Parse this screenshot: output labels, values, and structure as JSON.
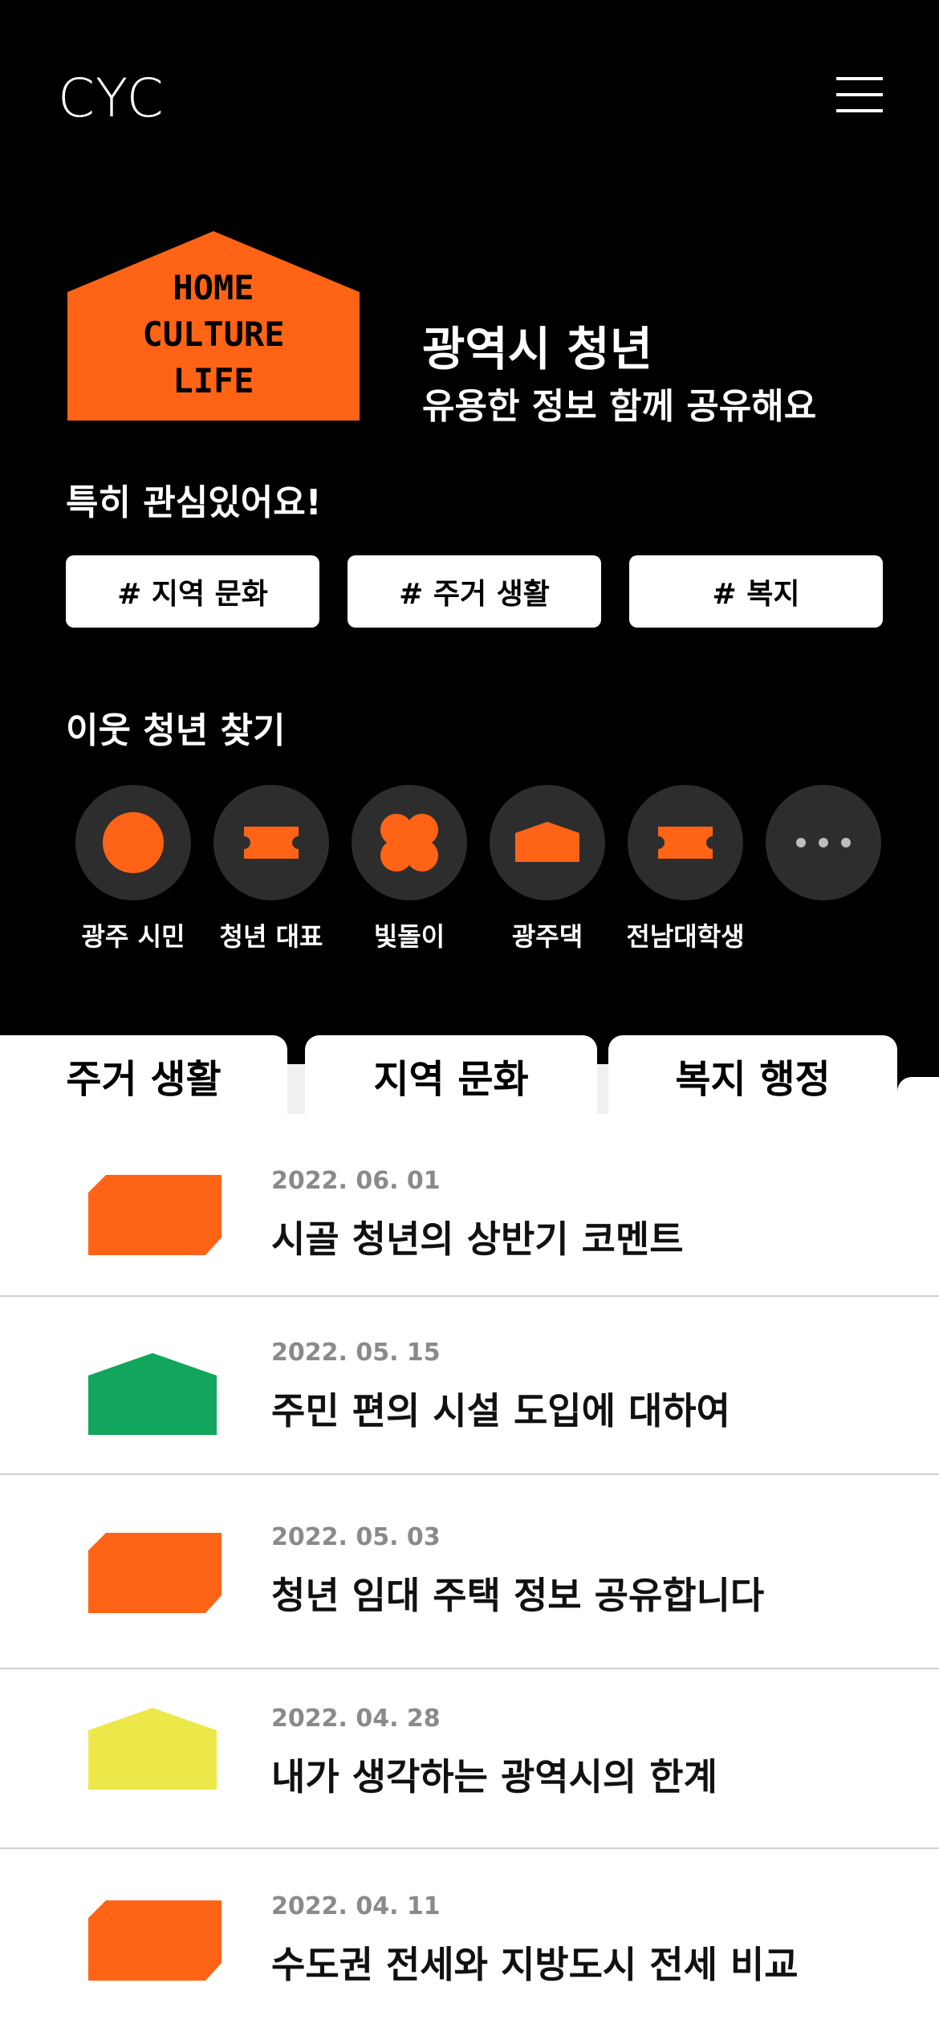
{
  "app": {
    "logo": "CYC"
  },
  "hero": {
    "house_lines": [
      "HOME",
      "CULTURE",
      "LIFE"
    ],
    "title": "광역시 청년",
    "subtitle": "유용한 정보 함께 공유해요"
  },
  "interests": {
    "title": "특히 관심있어요!",
    "chips": [
      "# 지역 문화",
      "# 주거 생활",
      "# 복지"
    ]
  },
  "neighbors": {
    "title": "이웃 청년 찾기",
    "items": [
      {
        "label": "광주 시민",
        "icon": "circle-icon"
      },
      {
        "label": "청년 대표",
        "icon": "ticket-icon"
      },
      {
        "label": "빛돌이",
        "icon": "flower-icon"
      },
      {
        "label": "광주댁",
        "icon": "house-icon"
      },
      {
        "label": "전남대학생",
        "icon": "ticket-icon"
      },
      {
        "label": "",
        "icon": "more-icon"
      }
    ]
  },
  "tabs": [
    "주거 생활",
    "지역 문화",
    "복지 행정"
  ],
  "posts": [
    {
      "date": "2022. 06. 01",
      "title": "시골 청년의 상반기 코멘트",
      "shape": "badge",
      "color": "#ff6416"
    },
    {
      "date": "2022. 05. 15",
      "title": "주민 편의 시설 도입에 대하여",
      "shape": "house",
      "color": "#12a55c"
    },
    {
      "date": "2022. 05. 03",
      "title": "청년 임대 주택 정보 공유합니다",
      "shape": "badge",
      "color": "#ff6416"
    },
    {
      "date": "2022. 04. 28",
      "title": "내가 생각하는 광역시의 한계",
      "shape": "house",
      "color": "#ece84a"
    },
    {
      "date": "2022. 04. 11",
      "title": "수도권 전세와 지방도시 전세 비교",
      "shape": "badge",
      "color": "#ff6416"
    }
  ],
  "colors": {
    "accent": "#ff6416",
    "dark_circle": "#2d2d2d"
  }
}
